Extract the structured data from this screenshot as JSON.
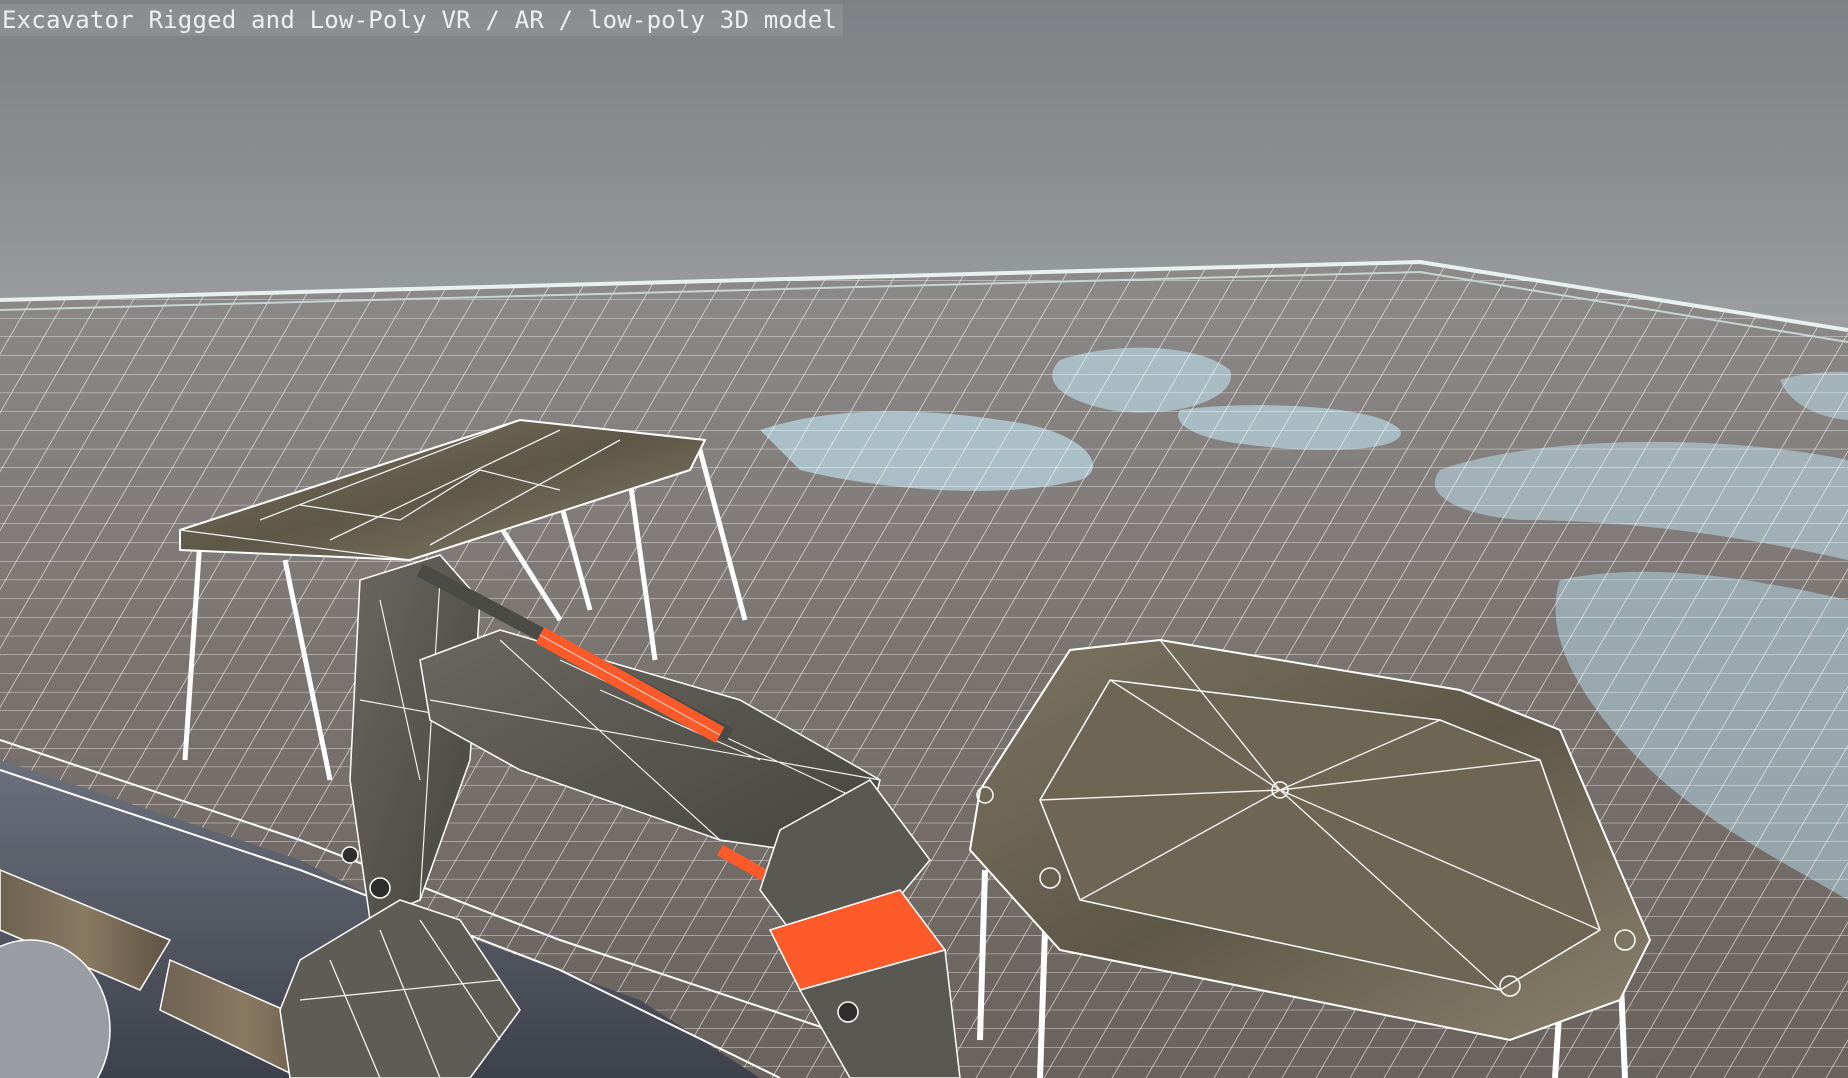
{
  "viewer": {
    "title": "Excavator Rigged and Low-Poly VR / AR / low-poly 3D model"
  },
  "scene": {
    "colors": {
      "background_top": "#7d8184",
      "background_horizon": "#a2a6a8",
      "ground": "#7a7470",
      "water": "#b8d4e0",
      "wireframe": "#ffffff",
      "machine_body": "#5a5852",
      "hydraulic_orange": "#ff5a2a",
      "stone_texture": "#6b6354",
      "track_dark": "#4a4d58"
    },
    "icons": [
      "viewport-3d",
      "wireframe-overlay"
    ]
  }
}
